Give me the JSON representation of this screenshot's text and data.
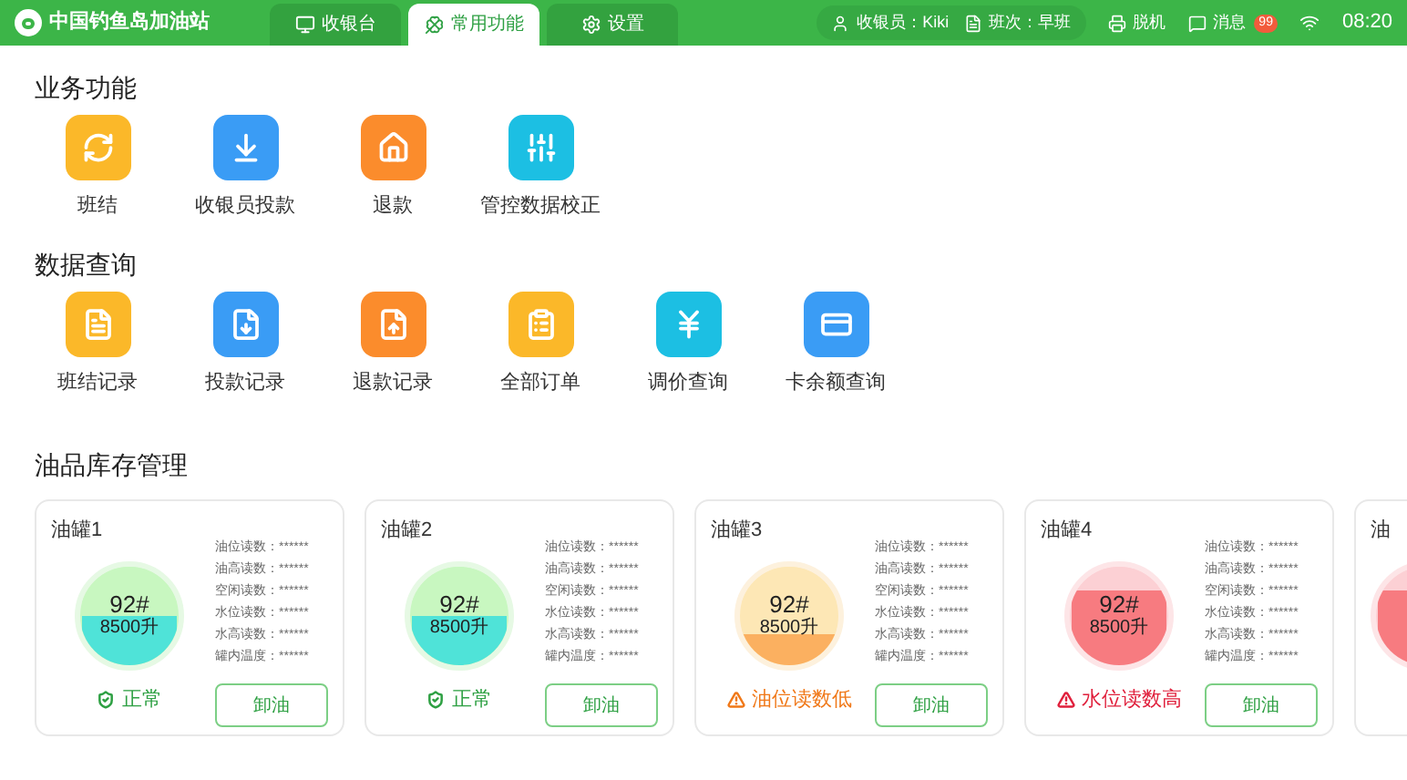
{
  "header": {
    "title": "中国钓鱼岛加油站",
    "tabs": [
      {
        "label": "收银台",
        "selected": false
      },
      {
        "label": "常用功能",
        "selected": true
      },
      {
        "label": "设置",
        "selected": false
      }
    ],
    "cashier": "收银员：Kiki",
    "shift": "班次：早班",
    "offline": "脱机",
    "messages": "消息",
    "badge": "99",
    "time": "08:20"
  },
  "sections": [
    {
      "title": "业务功能",
      "items": [
        {
          "label": "班结",
          "color": "#fbb829"
        },
        {
          "label": "收银员投款",
          "color": "#3a9cf5"
        },
        {
          "label": "退款",
          "color": "#fb8c2c"
        },
        {
          "label": "管控数据校正",
          "color": "#1cbfe3"
        }
      ]
    },
    {
      "title": "数据查询",
      "items": [
        {
          "label": "班结记录",
          "color": "#fbb829"
        },
        {
          "label": "投款记录",
          "color": "#3a9cf5"
        },
        {
          "label": "退款记录",
          "color": "#fb8c2c"
        },
        {
          "label": "全部订单",
          "color": "#fbb829"
        },
        {
          "label": "调价查询",
          "color": "#1cbfe3"
        },
        {
          "label": "卡余额查询",
          "color": "#3a9cf5"
        }
      ]
    }
  ],
  "inventory": {
    "title": "油品库存管理",
    "tanks": [
      {
        "name": "油罐1",
        "grade": "92#",
        "volume": "8500升",
        "level": 0.5,
        "kind": "normal",
        "status_text": "正常",
        "readings": [
          {
            "label": "油位读数：",
            "value": "******"
          },
          {
            "label": "油高读数：",
            "value": "******"
          },
          {
            "label": "空闲读数：",
            "value": "******"
          },
          {
            "label": "水位读数：",
            "value": "******"
          },
          {
            "label": "水高读数：",
            "value": "******"
          },
          {
            "label": "罐内温度：",
            "value": "******"
          }
        ],
        "button": "卸油"
      },
      {
        "name": "油罐2",
        "grade": "92#",
        "volume": "8500升",
        "level": 0.5,
        "kind": "normal",
        "status_text": "正常",
        "readings": [
          {
            "label": "油位读数：",
            "value": "******"
          },
          {
            "label": "油高读数：",
            "value": "******"
          },
          {
            "label": "空闲读数：",
            "value": "******"
          },
          {
            "label": "水位读数：",
            "value": "******"
          },
          {
            "label": "水高读数：",
            "value": "******"
          },
          {
            "label": "罐内温度：",
            "value": "******"
          }
        ],
        "button": "卸油"
      },
      {
        "name": "油罐3",
        "grade": "92#",
        "volume": "8500升",
        "level": 0.3,
        "kind": "low",
        "status_text": "油位读数低",
        "readings": [
          {
            "label": "油位读数：",
            "value": "******"
          },
          {
            "label": "油高读数：",
            "value": "******"
          },
          {
            "label": "空闲读数：",
            "value": "******"
          },
          {
            "label": "水位读数：",
            "value": "******"
          },
          {
            "label": "水高读数：",
            "value": "******"
          },
          {
            "label": "罐内温度：",
            "value": "******"
          }
        ],
        "button": "卸油"
      },
      {
        "name": "油罐4",
        "grade": "92#",
        "volume": "8500升",
        "level": 0.75,
        "kind": "high",
        "status_text": "水位读数高",
        "readings": [
          {
            "label": "油位读数：",
            "value": "******"
          },
          {
            "label": "油高读数：",
            "value": "******"
          },
          {
            "label": "空闲读数：",
            "value": "******"
          },
          {
            "label": "水位读数：",
            "value": "******"
          },
          {
            "label": "水高读数：",
            "value": "******"
          },
          {
            "label": "罐内温度：",
            "value": "******"
          }
        ],
        "button": "卸油"
      },
      {
        "name": "油",
        "level": 0.75,
        "kind": "high"
      }
    ]
  }
}
